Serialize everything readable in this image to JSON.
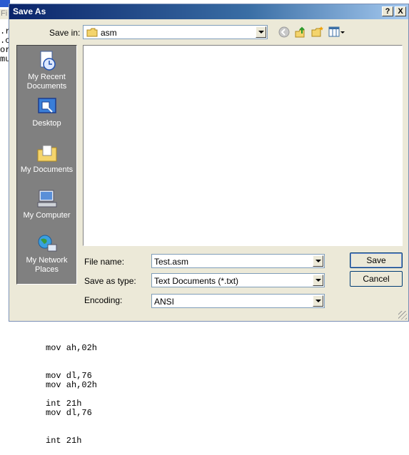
{
  "background": {
    "menu_fragment": "Fi",
    "left_fragments": [
      ".r",
      ".c",
      "or",
      "mu"
    ],
    "code_block_1": [
      "mov ah,02h",
      "mov dl,76",
      "int 21h"
    ],
    "code_block_2": [
      "mov ah,02h",
      "mov dl,76",
      "int 21h"
    ]
  },
  "dialog": {
    "title": "Save As",
    "help_button": "?",
    "close_button": "X",
    "save_in_label": "Save in:",
    "save_in_value": "asm",
    "places": [
      {
        "label": "My Recent Documents",
        "icon": "recent-documents-icon"
      },
      {
        "label": "Desktop",
        "icon": "desktop-icon"
      },
      {
        "label": "My Documents",
        "icon": "my-documents-icon"
      },
      {
        "label": "My Computer",
        "icon": "my-computer-icon"
      },
      {
        "label": "My Network Places",
        "icon": "network-places-icon"
      }
    ],
    "file_name_label": "File name:",
    "file_name_value": "Test.asm",
    "save_as_type_label": "Save as type:",
    "save_as_type_value": "Text Documents (*.txt)",
    "encoding_label": "Encoding:",
    "encoding_value": "ANSI",
    "save_button": "Save",
    "cancel_button": "Cancel"
  }
}
